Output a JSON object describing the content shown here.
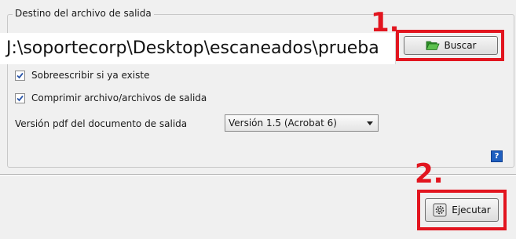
{
  "group": {
    "title": "Destino del archivo de salida"
  },
  "path_field": {
    "value": "J:\\soportecorp\\Desktop\\escaneados\\prueba"
  },
  "annotations": {
    "step1": "1.",
    "step2": "2."
  },
  "buttons": {
    "browse_label": "Buscar",
    "browse_icon": "folder-open-icon",
    "run_label": "Ejecutar",
    "run_icon": "gear-icon"
  },
  "options": {
    "overwrite_label": "Sobreescribir si ya existe",
    "overwrite_checked": true,
    "compress_label": "Comprimir archivo/archivos de salida",
    "compress_checked": true
  },
  "pdf_version": {
    "label": "Versión pdf del documento de salida",
    "selected": "Versión 1.5 (Acrobat 6)"
  },
  "help": {
    "glyph": "?"
  },
  "colors": {
    "annotation": "#e2151f",
    "help_icon": "#1f5fbf",
    "folder_icon": "#3fa535"
  }
}
